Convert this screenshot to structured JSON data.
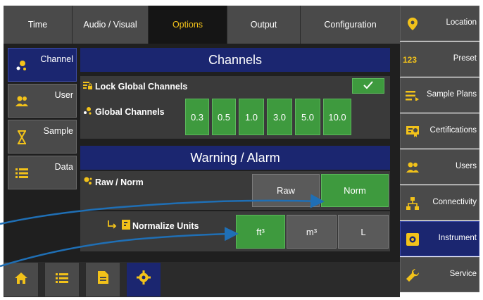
{
  "tabs": [
    {
      "label": "Time"
    },
    {
      "label": "Audio / Visual"
    },
    {
      "label": "Options"
    },
    {
      "label": "Output"
    },
    {
      "label": "Configuration"
    }
  ],
  "subnav": [
    {
      "label": "Channel",
      "icon": "dots-icon",
      "active": true
    },
    {
      "label": "User",
      "icon": "users-icon"
    },
    {
      "label": "Sample",
      "icon": "hourglass-icon"
    },
    {
      "label": "Data",
      "icon": "list-icon"
    }
  ],
  "channels": {
    "title": "Channels",
    "lock_label": "Lock Global Channels",
    "lock_checked": true,
    "global_label": "Global Channels",
    "values": [
      "0.3",
      "0.5",
      "1.0",
      "3.0",
      "5.0",
      "10.0"
    ]
  },
  "warning": {
    "title": "Warning / Alarm",
    "raw_norm_label": "Raw / Norm",
    "raw": "Raw",
    "norm": "Norm",
    "normalize_label": "Normalize Units",
    "units": [
      "ft³",
      "m³",
      "L"
    ],
    "selected_unit": "ft³",
    "selected_mode": "Norm"
  },
  "sidebar": [
    {
      "label": "Location",
      "icon": "location-pin-icon"
    },
    {
      "label": "Preset",
      "icon": "123-icon"
    },
    {
      "label": "Sample Plans",
      "icon": "sample-plans-icon"
    },
    {
      "label": "Certifications",
      "icon": "certificate-icon"
    },
    {
      "label": "Users",
      "icon": "users-icon"
    },
    {
      "label": "Connectivity",
      "icon": "network-icon"
    },
    {
      "label": "Instrument",
      "icon": "gear-icon",
      "active": true
    },
    {
      "label": "Service",
      "icon": "wrench-icon"
    }
  ],
  "bottom": [
    {
      "icon": "home-icon"
    },
    {
      "icon": "list-icon"
    },
    {
      "icon": "document-icon"
    },
    {
      "icon": "gear-icon",
      "active": true
    }
  ],
  "colors": {
    "accent": "#f2c21a",
    "selected_green": "#3e9a3e",
    "header_blue": "#1b2670",
    "arrow_blue": "#1f6fb5"
  }
}
